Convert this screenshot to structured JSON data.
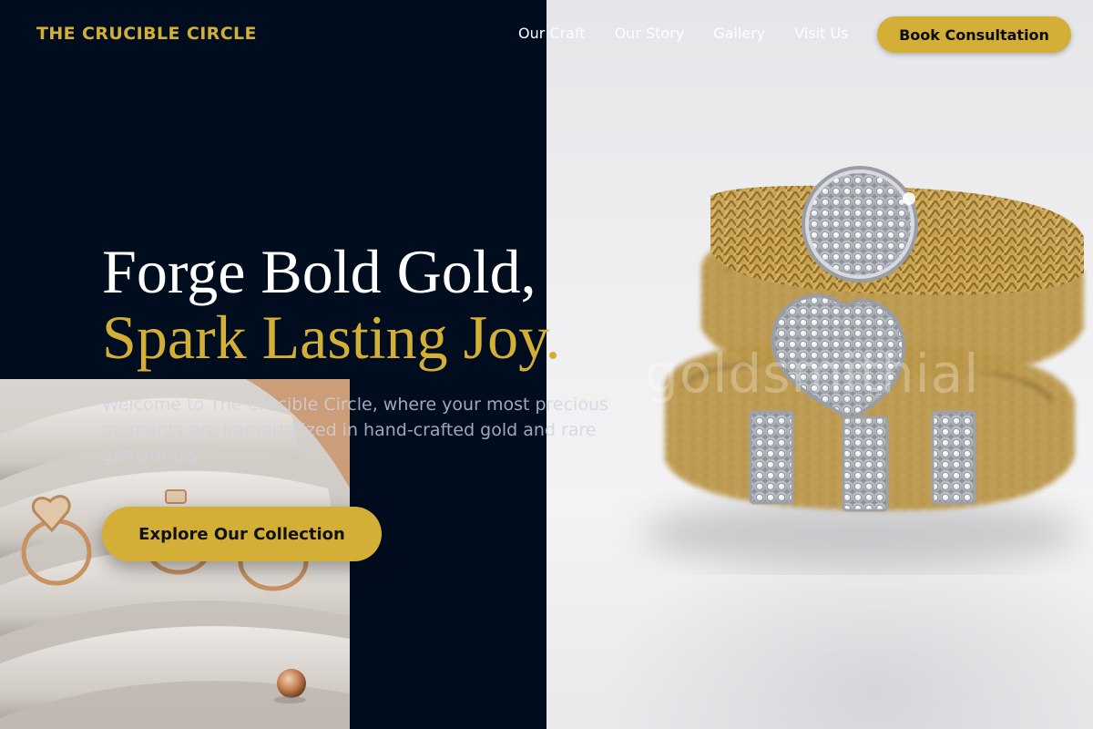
{
  "brand": {
    "name": "THE CRUCIBLE CIRCLE",
    "accent_color": "#d4af37",
    "background_color": "#000d1f"
  },
  "nav": {
    "items": [
      {
        "label": "Our Craft"
      },
      {
        "label": "Our Story"
      },
      {
        "label": "Gallery"
      },
      {
        "label": "Visit Us"
      }
    ],
    "cta_label": "Book Consultation"
  },
  "hero": {
    "headline_line1": "Forge Bold Gold,",
    "headline_line2": "Spark Lasting Joy.",
    "subtitle": "Welcome to The Crucible Circle, where your most precious moments are immortalized in hand-crafted gold and rare gemstones.",
    "cta_label": "Explore Our Collection",
    "photo_watermark": "goldsmithial"
  }
}
